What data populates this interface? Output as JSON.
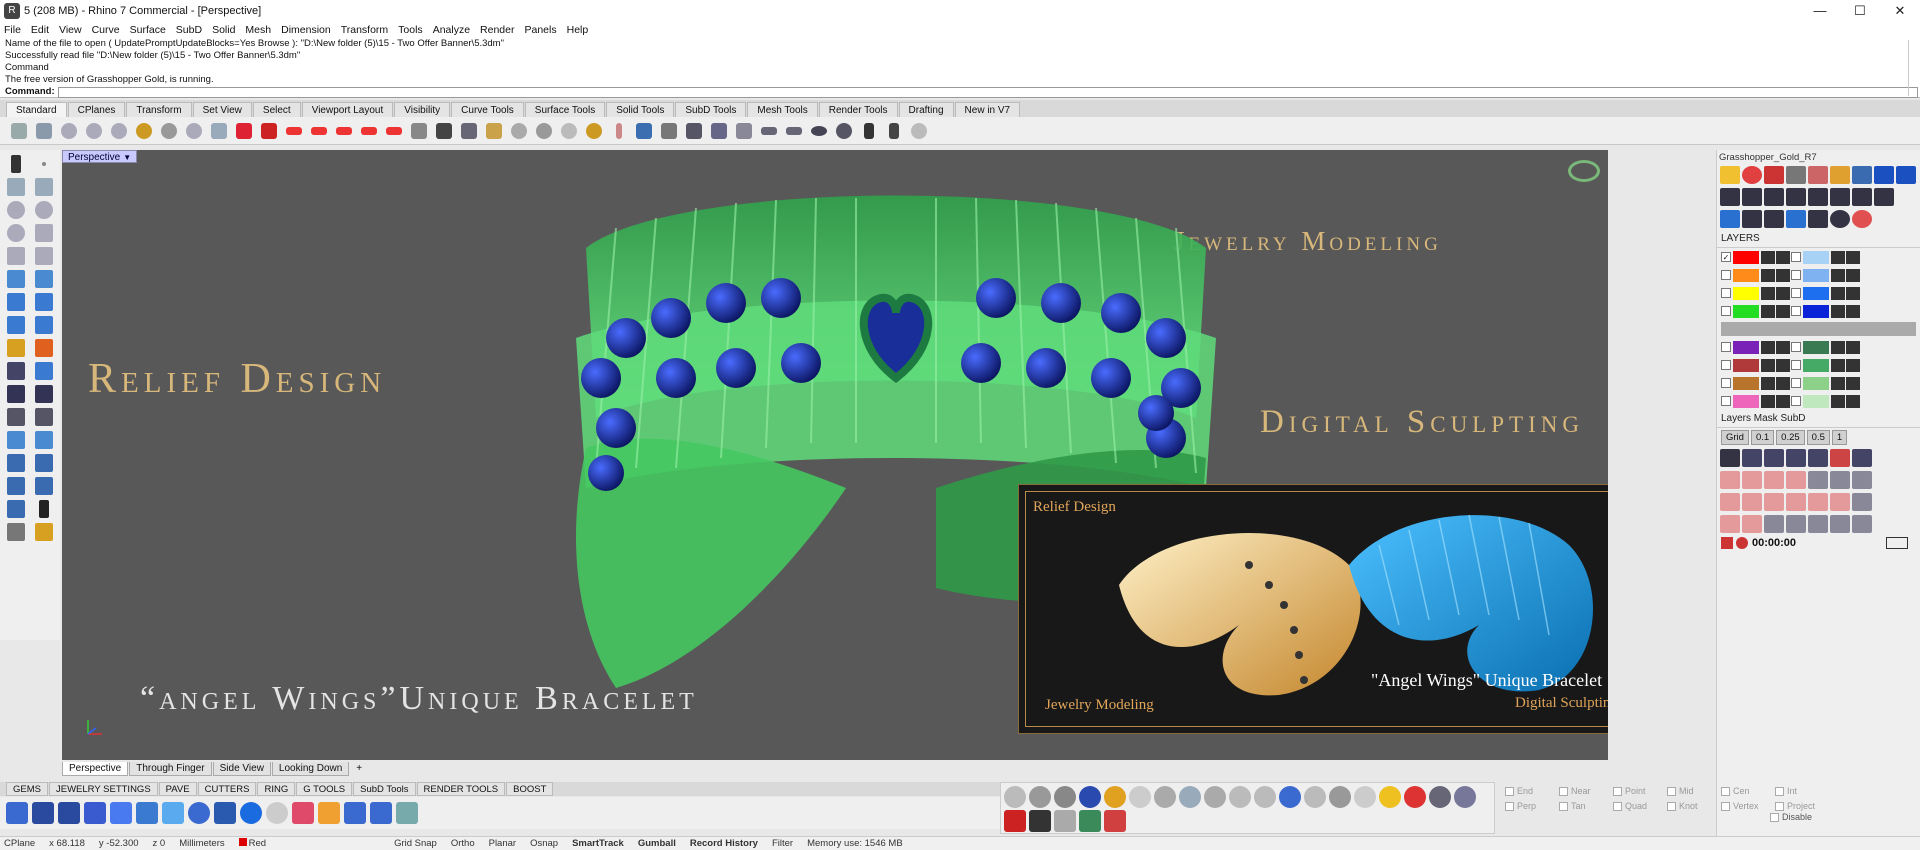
{
  "window": {
    "title": "5 (208 MB) - Rhino 7 Commercial - [Perspective]",
    "app_icon": "R",
    "minimize": "—",
    "maximize": "☐",
    "close": "✕"
  },
  "menu": [
    "File",
    "Edit",
    "View",
    "Curve",
    "Surface",
    "SubD",
    "Solid",
    "Mesh",
    "Dimension",
    "Transform",
    "Tools",
    "Analyze",
    "Render",
    "Panels",
    "Help"
  ],
  "command": {
    "history": [
      "Name of the file to open ( UpdatePromptUpdateBlocks=Yes  Browse ): \"D:\\New folder (5)\\15 - Two Offer Banner\\5.3dm\"",
      "Successfully read file \"D:\\New folder (5)\\15 - Two Offer Banner\\5.3dm\"",
      "Command",
      "The free version of Grasshopper Gold, is running."
    ],
    "prompt_label": "Command:"
  },
  "toolbar_tabs": [
    "Standard",
    "CPlanes",
    "Transform",
    "Set View",
    "Select",
    "Viewport Layout",
    "Visibility",
    "Curve Tools",
    "Surface Tools",
    "Solid Tools",
    "SubD Tools",
    "Mesh Tools",
    "Render Tools",
    "Drafting",
    "New in V7"
  ],
  "viewport": {
    "label": "Perspective",
    "label_dropdown": "▼",
    "texts": {
      "relief": "Relief Design",
      "jewelry": "Jewelry Modeling",
      "sculpt": "Digital Sculpting",
      "angel": "“angel Wings”Unique Bracelet"
    },
    "inset": {
      "relief": "Relief Design",
      "jewelry": "Jewelry Modeling",
      "angel": "\"Angel Wings\" Unique Bracelet",
      "sculpt": "Digital Sculpting"
    },
    "colors": {
      "gold_text": "#d8b77b",
      "bg": "#585858",
      "green": "#3fd36a",
      "blue_gem": "#1a2e9a"
    }
  },
  "viewport_tabs": [
    "Perspective",
    "Through Finger",
    "Side View",
    "Looking Down",
    "+"
  ],
  "right_panel": {
    "title": "Grasshopper_Gold_R7",
    "layers_header": "LAYERS",
    "layers": [
      {
        "color": "#ff0000",
        "checked": "✓",
        "alt": "#a8d2f5"
      },
      {
        "color": "#ff8c1a",
        "checked": "",
        "alt": "#7fb2f0"
      },
      {
        "color": "#ffff00",
        "checked": "",
        "alt": "#1e6ff0"
      },
      {
        "color": "#22dd22",
        "checked": "",
        "alt": "#0a22d8"
      },
      {
        "color": "#7a22b8",
        "checked": "",
        "alt": "#3a7a52"
      },
      {
        "color": "#b03a3a",
        "checked": "",
        "alt": "#44aa66"
      },
      {
        "color": "#b8742a",
        "checked": "",
        "alt": "#8cd08a"
      },
      {
        "color": "#ee66bb",
        "checked": "",
        "alt": "#bfe8bf"
      }
    ],
    "subd_header": "Layers Mask SubD",
    "subd_buttons": [
      "Grid",
      "0.1",
      "0.25",
      "0.5",
      "1"
    ],
    "timer": "00:00:00"
  },
  "bottom_tabs": [
    "GEMS",
    "JEWELRY SETTINGS",
    "PAVE",
    "CUTTERS",
    "RING",
    "G TOOLS",
    "SubD Tools",
    "RENDER TOOLS",
    "BOOST"
  ],
  "osnap": [
    "End",
    "Near",
    "Point",
    "Mid",
    "Cen",
    "Int",
    "Perp",
    "Tan",
    "Quad",
    "Knot",
    "Vertex",
    "Project",
    "Disable"
  ],
  "status": {
    "cplane": "CPlane",
    "x": "x 68.118",
    "y": "y -52.300",
    "z": "z 0",
    "units": "Millimeters",
    "layer": "Red",
    "grid_snap": "Grid Snap",
    "ortho": "Ortho",
    "planar": "Planar",
    "osnap": "Osnap",
    "smarttrack": "SmartTrack",
    "gumball": "Gumball",
    "record": "Record History",
    "filter": "Filter",
    "memory": "Memory use: 1546 MB"
  }
}
